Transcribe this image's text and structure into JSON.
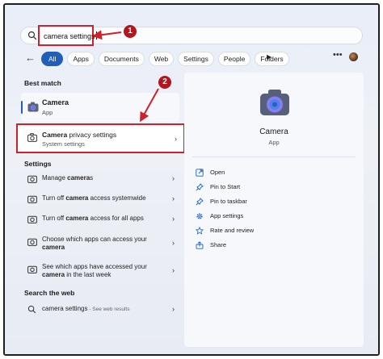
{
  "search": {
    "query": "camera settings"
  },
  "callouts": {
    "one": "1",
    "two": "2"
  },
  "filters": {
    "chips": [
      "All",
      "Apps",
      "Documents",
      "Web",
      "Settings",
      "People",
      "Folders"
    ]
  },
  "best_match": {
    "heading": "Best match",
    "title": "Camera",
    "subtitle": "App"
  },
  "privacy": {
    "title_bold": "Camera",
    "title_rest": " privacy settings",
    "subtitle": "System settings"
  },
  "settings": {
    "heading": "Settings",
    "items": [
      {
        "pre": "Manage ",
        "bold": "camera",
        "post": "s",
        "pre2": "",
        "bold2": "",
        "post2": ""
      },
      {
        "pre": "Turn off ",
        "bold": "camera",
        "post": " access systemwide",
        "pre2": "",
        "bold2": "",
        "post2": ""
      },
      {
        "pre": "Turn off ",
        "bold": "camera",
        "post": " access for all apps",
        "pre2": "",
        "bold2": "",
        "post2": ""
      },
      {
        "pre": "Choose which apps can access your",
        "bold": "",
        "post": "",
        "pre2": "",
        "bold2": "camera",
        "post2": ""
      },
      {
        "pre": "See which apps have accessed your",
        "bold": "",
        "post": "",
        "pre2": "",
        "bold2": "camera",
        "post2": " in the last week"
      }
    ]
  },
  "web": {
    "heading": "Search the web",
    "query": "camera settings",
    "suffix": " - See web results"
  },
  "detail": {
    "title": "Camera",
    "subtitle": "App",
    "actions": [
      "Open",
      "Pin to Start",
      "Pin to taskbar",
      "App settings",
      "Rate and review",
      "Share"
    ]
  },
  "colors": {
    "accent": "#1f5fb8",
    "highlight": "#d0202a",
    "badge": "#b3161d"
  }
}
